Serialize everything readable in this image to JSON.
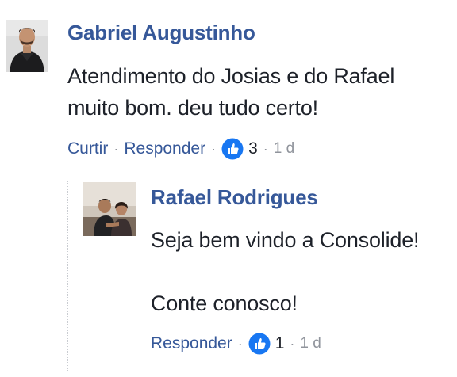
{
  "comment": {
    "author": "Gabriel Augustinho",
    "text": "Atendimento do Josias e do Rafael muito bom. deu tudo certo!",
    "actions": {
      "like_label": "Curtir",
      "reply_label": "Responder",
      "separator": "·",
      "reaction_icon": "thumbs-up-icon",
      "reaction_count": "3",
      "time": "1 d"
    }
  },
  "reply": {
    "author": "Rafael Rodrigues",
    "text_line1": "Seja bem vindo a Consolide!",
    "text_line2": "Conte conosco!",
    "actions": {
      "reply_label": "Responder",
      "separator": "·",
      "reaction_icon": "thumbs-up-icon",
      "reaction_count": "1",
      "time": "1 d"
    }
  },
  "colors": {
    "link": "#365899",
    "text": "#1d2129",
    "meta": "#90949c",
    "like_blue": "#1877f2"
  }
}
